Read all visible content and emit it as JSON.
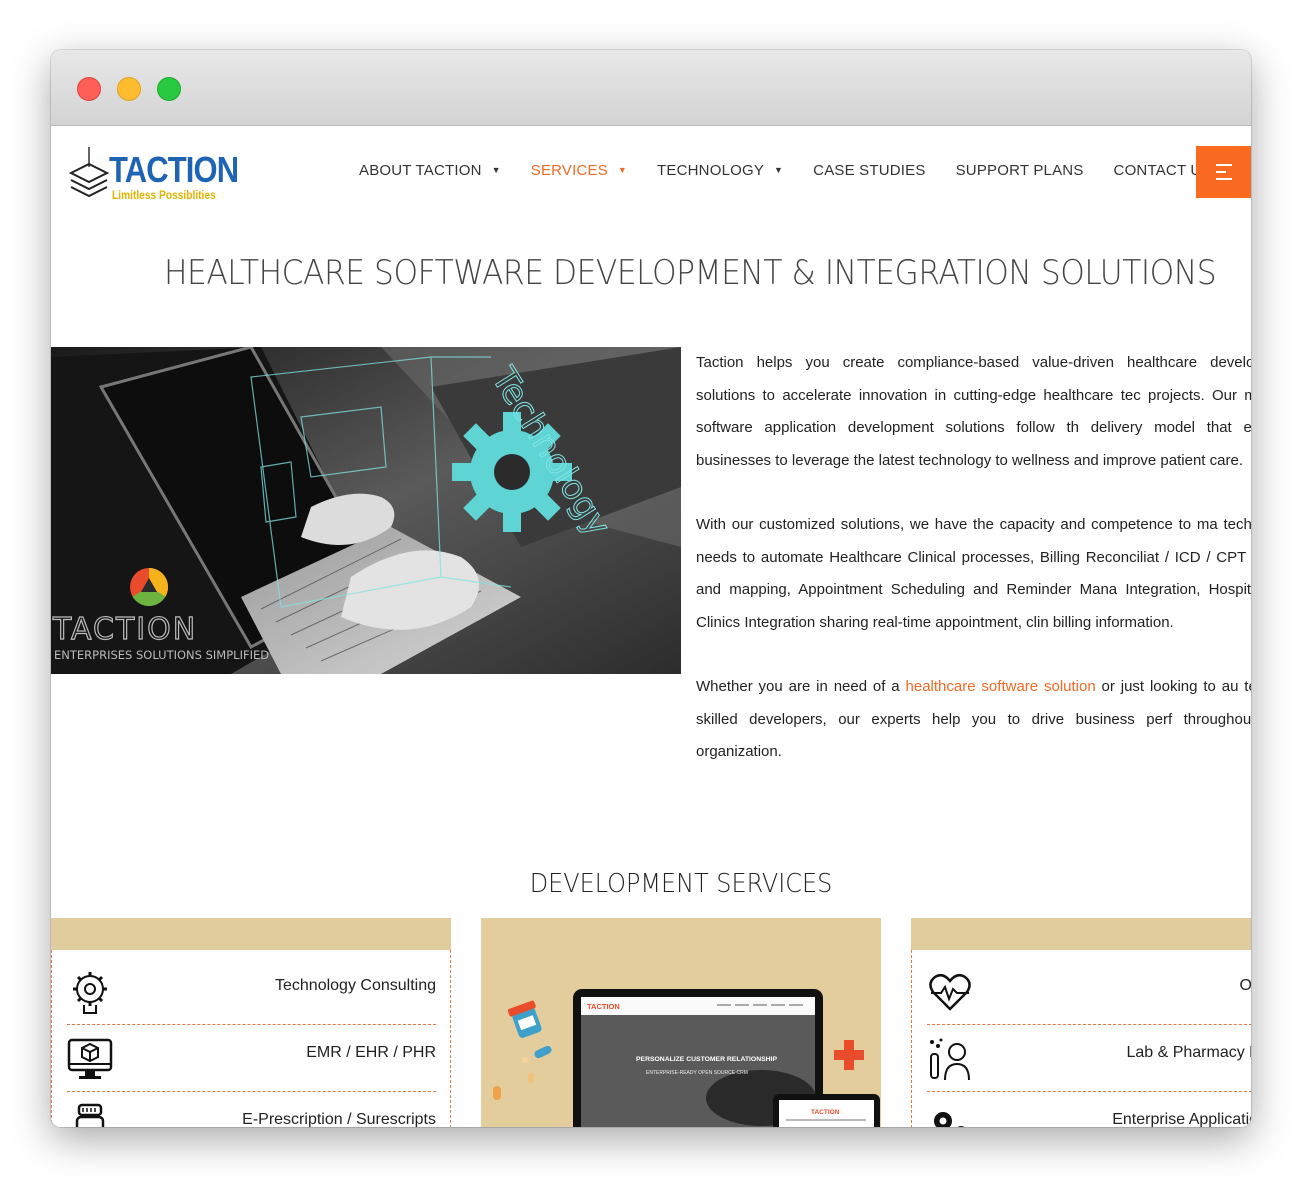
{
  "brand": {
    "name": "TACTION",
    "tagline": "Limitless Possiblities"
  },
  "nav": {
    "items": [
      {
        "label": "ABOUT TACTION",
        "has_dropdown": true
      },
      {
        "label": "SERVICES",
        "has_dropdown": true,
        "active": true
      },
      {
        "label": "TECHNOLOGY",
        "has_dropdown": true
      },
      {
        "label": "CASE STUDIES",
        "has_dropdown": false
      },
      {
        "label": "SUPPORT PLANS",
        "has_dropdown": false
      },
      {
        "label": "CONTACT US",
        "has_dropdown": false
      }
    ],
    "menu_icon": "hamburger-icon"
  },
  "page": {
    "title": "HEALTHCARE SOFTWARE DEVELOPMENT & INTEGRATION SOLUTIONS",
    "hero_image": {
      "overlay_word": "Technology",
      "logo_text": "TACTION",
      "logo_sub": "ENTERPRISES SOLUTIONS SIMPLIFIED"
    },
    "paragraphs": {
      "p1": "Taction helps you create compliance-based value-driven healthcare development solutions to accelerate innovation in cutting-edge healthcare tec projects. Our medical software application development solutions follow th delivery model that enables businesses to leverage the latest technology to wellness and improve patient care.",
      "p2": "With our customized solutions, we have the capacity and competence to ma technology needs to automate Healthcare Clinical processes, Billing Reconciliat / ICD / CPT coding and mapping, Appointment Scheduling and Reminder Mana Integration, Hospital and Clinics Integration sharing real-time appointment, clin billing information.",
      "p3_before": "Whether you are in need of a ",
      "p3_link": "healthcare software solution",
      "p3_after": " or just looking to au team of skilled developers, our experts help you to drive business perf throughout your organization."
    }
  },
  "services": {
    "title": "DEVELOPMENT SERVICES",
    "left": [
      {
        "label": "Technology Consulting",
        "icon": "gear-head-icon"
      },
      {
        "label": "EMR / EHR / PHR",
        "icon": "monitor-cube-icon"
      },
      {
        "label": "E-Prescription / Surescripts",
        "icon": "pill-bottle-icon"
      }
    ],
    "right": [
      {
        "label": "ONC",
        "icon": "heartbeat-icon"
      },
      {
        "label": "Lab & Pharmacy Manage",
        "icon": "lab-doctor-icon"
      },
      {
        "label": "Enterprise Application Integ",
        "icon": "gears-icon"
      }
    ],
    "mockup": {
      "screen_headline": "PERSONALIZE CUSTOMER RELATIONSHIP",
      "screen_sub": "ENTERPRISE-READY OPEN SOURCE CRM",
      "screen_logo": "TACTION"
    }
  },
  "colors": {
    "accent": "#f06a25",
    "brand_blue": "#1e63b4",
    "card_tan": "#e0cc9d"
  }
}
